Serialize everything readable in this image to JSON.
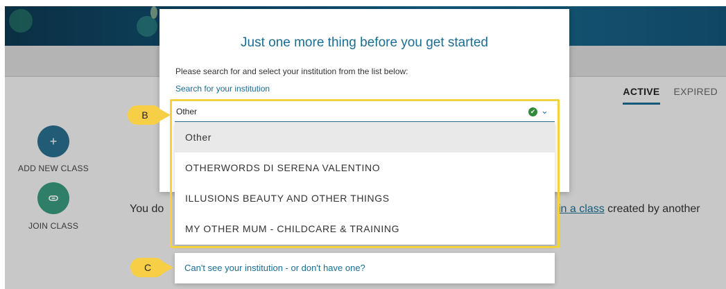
{
  "modal": {
    "title": "Just one more thing before you get started",
    "instruction": "Please search for and select your institution from the list below:",
    "search_link": "Search for your institution",
    "search_value": "Other",
    "options": [
      "Other",
      "OTHERWORDS DI SERENA VALENTINO",
      "ILLUSIONS BEAUTY AND OTHER THINGS",
      "MY OTHER MUM - CHILDCARE & TRAINING"
    ],
    "cant_see_link": "Can't see your institution - or don't have one?"
  },
  "tabs": {
    "active": "ACTIVE",
    "expired": "EXPIRED"
  },
  "sidebar": {
    "add_label": "ADD NEW CLASS",
    "add_icon": "+",
    "join_label": "JOIN CLASS"
  },
  "background_text": {
    "left_fragment": "You do",
    "link_fragment": "in a class",
    "right_fragment": " created by another"
  },
  "callouts": {
    "b": "B",
    "c": "C"
  },
  "colors": {
    "accent": "#1a6d93",
    "callout": "#f7cf46",
    "success": "#2f8a3a",
    "add_button": "#2a6f8f",
    "join_button": "#3a9a7e"
  }
}
